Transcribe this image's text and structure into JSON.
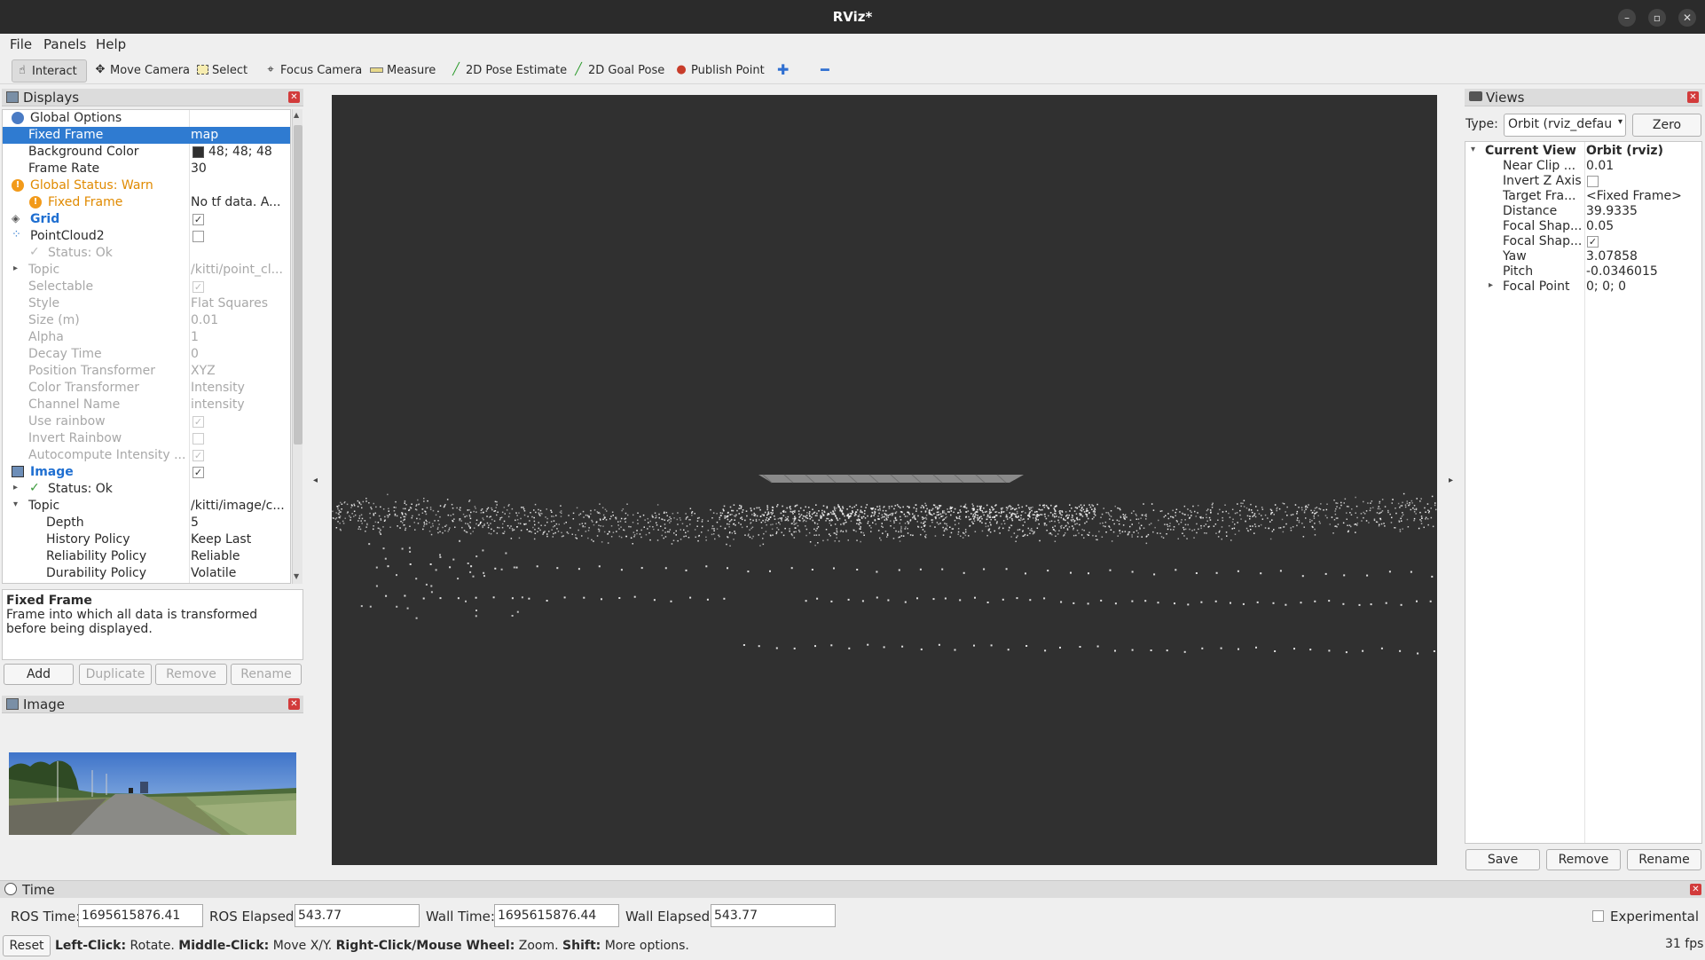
{
  "window": {
    "title": "RViz*"
  },
  "menu": {
    "file": "File",
    "panels": "Panels",
    "help": "Help"
  },
  "toolbar": {
    "interact": "Interact",
    "move_camera": "Move Camera",
    "select": "Select",
    "focus_camera": "Focus Camera",
    "measure": "Measure",
    "pose_estimate": "2D Pose Estimate",
    "goal_pose": "2D Goal Pose",
    "publish_point": "Publish Point"
  },
  "displays": {
    "title": "Displays",
    "rows": [
      {
        "name": "Global Options",
        "value": ""
      },
      {
        "name": "Fixed Frame",
        "value": "map"
      },
      {
        "name": "Background Color",
        "value": "48; 48; 48"
      },
      {
        "name": "Frame Rate",
        "value": "30"
      },
      {
        "name": "Global Status: Warn",
        "value": ""
      },
      {
        "name": "Fixed Frame",
        "value": "No tf data.  A..."
      },
      {
        "name": "Grid",
        "value": ""
      },
      {
        "name": "PointCloud2",
        "value": ""
      },
      {
        "name": "Status: Ok",
        "value": ""
      },
      {
        "name": "Topic",
        "value": "/kitti/point_cl..."
      },
      {
        "name": "Selectable",
        "value": ""
      },
      {
        "name": "Style",
        "value": "Flat Squares"
      },
      {
        "name": "Size (m)",
        "value": "0.01"
      },
      {
        "name": "Alpha",
        "value": "1"
      },
      {
        "name": "Decay Time",
        "value": "0"
      },
      {
        "name": "Position Transformer",
        "value": "XYZ"
      },
      {
        "name": "Color Transformer",
        "value": "Intensity"
      },
      {
        "name": "Channel Name",
        "value": "intensity"
      },
      {
        "name": "Use rainbow",
        "value": ""
      },
      {
        "name": "Invert Rainbow",
        "value": ""
      },
      {
        "name": "Autocompute Intensity ...",
        "value": ""
      },
      {
        "name": "Image",
        "value": ""
      },
      {
        "name": "Status: Ok",
        "value": ""
      },
      {
        "name": "Topic",
        "value": "/kitti/image/c..."
      },
      {
        "name": "Depth",
        "value": "5"
      },
      {
        "name": "History Policy",
        "value": "Keep Last"
      },
      {
        "name": "Reliability Policy",
        "value": "Reliable"
      },
      {
        "name": "Durability Policy",
        "value": "Volatile"
      }
    ],
    "description_title": "Fixed Frame",
    "description_text": "Frame into which all data is transformed before being displayed.",
    "buttons": {
      "add": "Add",
      "duplicate": "Duplicate",
      "remove": "Remove",
      "rename": "Rename"
    },
    "background_swatch": "#303030"
  },
  "image_panel": {
    "title": "Image"
  },
  "views": {
    "title": "Views",
    "type_label": "Type:",
    "type_value": "Orbit (rviz_defau",
    "zero": "Zero",
    "rows": [
      {
        "name": "Current View",
        "value": "Orbit (rviz)"
      },
      {
        "name": "Near Clip ...",
        "value": "0.01"
      },
      {
        "name": "Invert Z Axis",
        "value": ""
      },
      {
        "name": "Target Fra...",
        "value": "<Fixed Frame>"
      },
      {
        "name": "Distance",
        "value": "39.9335"
      },
      {
        "name": "Focal Shap...",
        "value": "0.05"
      },
      {
        "name": "Focal Shap...",
        "value": ""
      },
      {
        "name": "Yaw",
        "value": "3.07858"
      },
      {
        "name": "Pitch",
        "value": "-0.0346015"
      },
      {
        "name": "Focal Point",
        "value": "0; 0; 0"
      }
    ],
    "buttons": {
      "save": "Save",
      "remove": "Remove",
      "rename": "Rename"
    }
  },
  "time": {
    "title": "Time",
    "ros_time_label": "ROS Time:",
    "ros_time": "1695615876.41",
    "ros_elapsed_label": "ROS Elapsed:",
    "ros_elapsed": "543.77",
    "wall_time_label": "Wall Time:",
    "wall_time": "1695615876.44",
    "wall_elapsed_label": "Wall Elapsed:",
    "wall_elapsed": "543.77",
    "experimental": "Experimental"
  },
  "statusbar": {
    "reset": "Reset",
    "left_click": "Left-Click:",
    "left_click_action": " Rotate. ",
    "middle_click": "Middle-Click:",
    "middle_click_action": " Move X/Y. ",
    "right_click": "Right-Click/Mouse Wheel:",
    "right_click_action": " Zoom. ",
    "shift": "Shift:",
    "shift_action": " More options.",
    "fps": "31 fps"
  },
  "colors": {
    "accent": "#2f7bd1",
    "warn": "#e08a00",
    "viewport_bg": "#303030",
    "titlebar": "#2b2b2b"
  }
}
